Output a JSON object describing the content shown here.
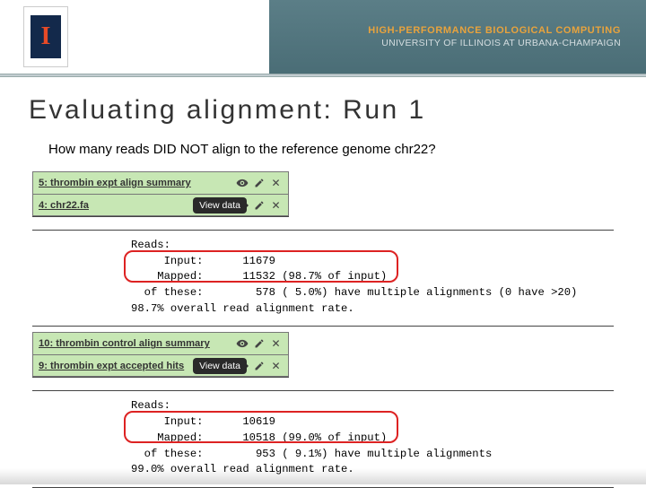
{
  "header": {
    "line1": "HIGH-PERFORMANCE BIOLOGICAL COMPUTING",
    "line2": "UNIVERSITY OF ILLINOIS AT URBANA-CHAMPAIGN",
    "logo_letter": "I"
  },
  "title": "Evaluating alignment: Run 1",
  "question": "How many reads DID NOT align to the reference genome chr22?",
  "tooltip": "View data",
  "panel1": {
    "items": [
      {
        "label": "5: thrombin expt align summary"
      },
      {
        "label": "4: chr22.fa"
      }
    ],
    "log_heading": "Reads:",
    "log_line1": "     Input:      11679",
    "log_line2": "    Mapped:      11532 (98.7% of input)",
    "log_line3": "  of these:        578 ( 5.0%) have multiple alignments (0 have >20)",
    "log_line4": "98.7% overall read alignment rate."
  },
  "panel2": {
    "items": [
      {
        "label": "10: thrombin control align summary"
      },
      {
        "label": "9: thrombin expt accepted hits"
      }
    ],
    "log_heading": "Reads:",
    "log_line1": "     Input:      10619",
    "log_line2": "    Mapped:      10518 (99.0% of input)",
    "log_line3": "  of these:        953 ( 9.1%) have multiple alignments",
    "log_line4": "99.0% overall read alignment rate."
  }
}
